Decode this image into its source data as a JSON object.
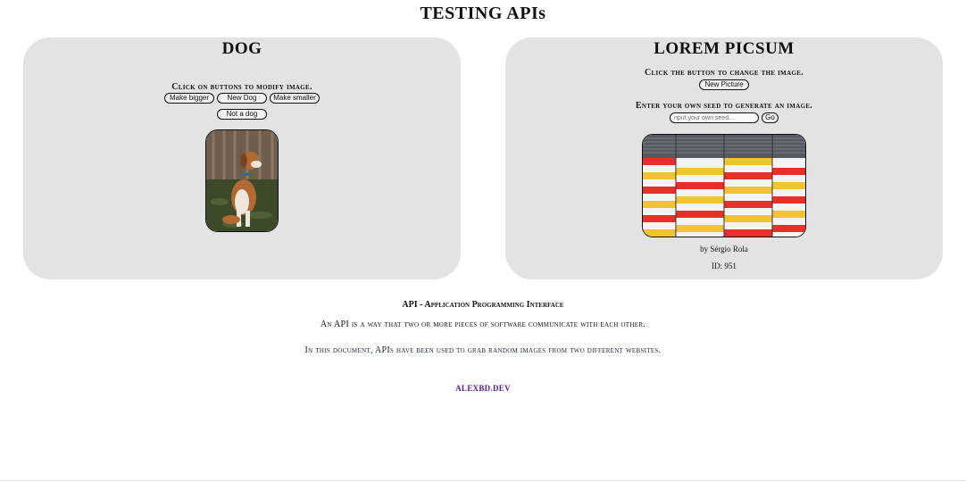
{
  "page": {
    "title": "TESTING APIs"
  },
  "dog_card": {
    "title": "DOG",
    "instruction": "Click on buttons to modify image.",
    "buttons": {
      "bigger": "Make bigger",
      "new_dog": "New Dog",
      "smaller": "Make smaller",
      "not_dog": "Not a dog"
    },
    "image_icon": "dog-photo"
  },
  "lorem_card": {
    "title": "LOREM PICSUM",
    "instruction": "Click the button to change the image.",
    "new_picture_label": "New Picture",
    "seed_instruction": "Enter your own seed to generate an image.",
    "seed_placeholder": "nput your own seed...",
    "go_label": "Go",
    "image_icon": "striped-building-photo",
    "author": "by Sérgio Rola",
    "id_text": "ID: 951"
  },
  "info": {
    "heading": "API - Application Programming Interface",
    "line1": "An API is a way that two or more pieces of software communicate with each other.",
    "line2": "In this document, APIs have been used to grab random images from two different websites."
  },
  "footer": {
    "link": "ALEXBD.DEV"
  },
  "colors": {
    "card_bg": "#e3e3e3",
    "link": "#5a1a86"
  }
}
